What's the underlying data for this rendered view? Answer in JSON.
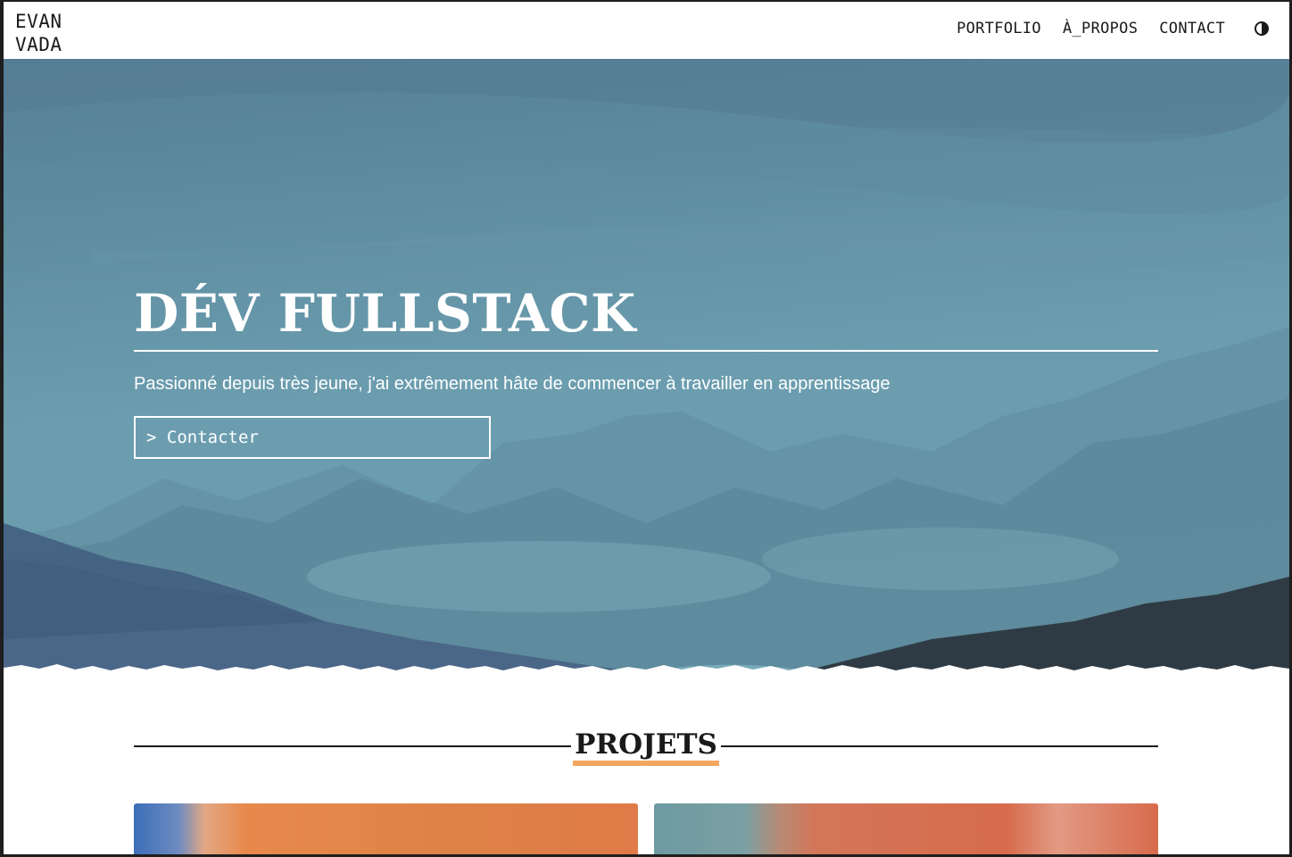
{
  "header": {
    "logo_line1": "EVAN",
    "logo_line2": "VADA",
    "nav": {
      "portfolio": "PORTFOLIO",
      "about": "À_PROPOS",
      "contact": "CONTACT"
    },
    "theme_icon": "contrast-icon"
  },
  "hero": {
    "title": "DÉV FULLSTACK",
    "subtitle": "Passionné depuis très jeune, j'ai extrêmement hâte de commencer à travailler en apprentissage",
    "cta_label": "> Contacter"
  },
  "projects": {
    "heading": "PROJETS",
    "accent_color": "#f4a65f"
  },
  "colors": {
    "sky": "#6a9eae",
    "mountains_dark": "#3e5a7c",
    "text_dark": "#1a1a1a"
  }
}
